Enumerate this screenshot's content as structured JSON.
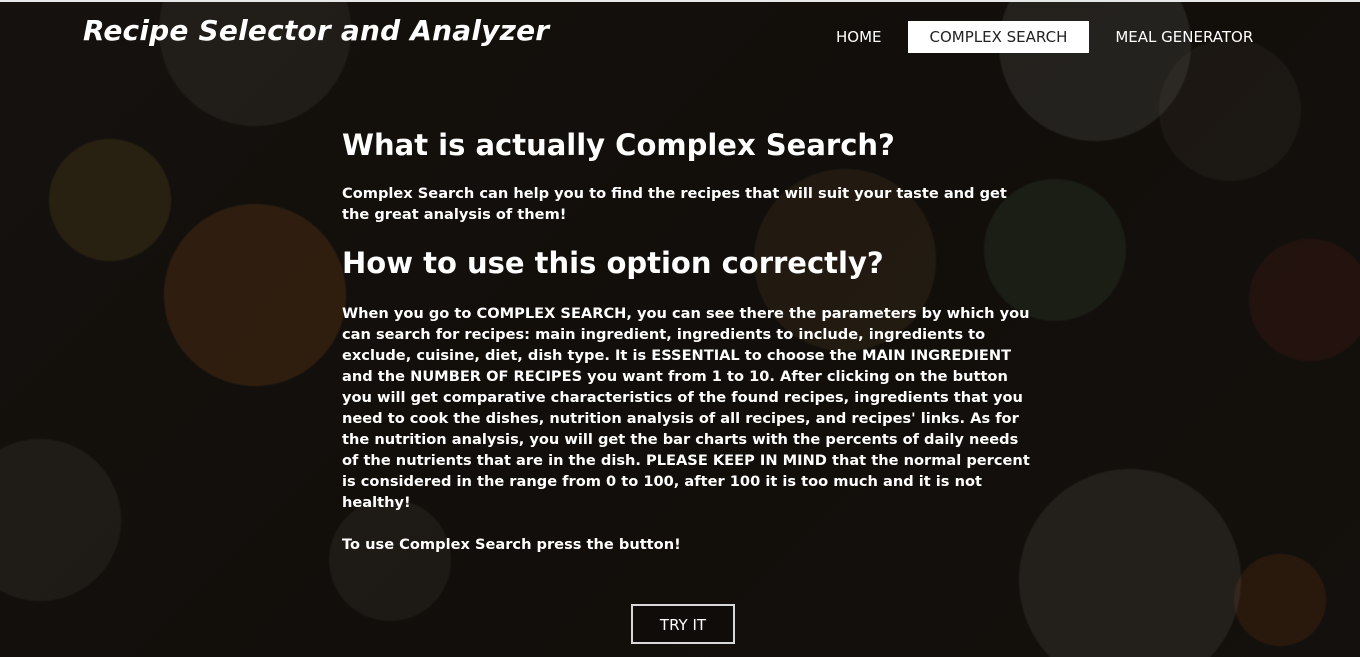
{
  "header": {
    "title": "Recipe Selector and Analyzer",
    "nav": [
      {
        "label": "HOME",
        "active": false
      },
      {
        "label": "COMPLEX SEARCH",
        "active": true
      },
      {
        "label": "MEAL GENERATOR",
        "active": false
      }
    ]
  },
  "main": {
    "heading1": "What is actually Complex Search?",
    "intro": "Complex Search can help you to find the recipes that will suit your taste and get the great analysis of them!",
    "heading2": "How to use this option correctly?",
    "body": "When you go to COMPLEX SEARCH, you can see there the parameters by which you can search for recipes: main ingredient, ingredients to include, ingredients to exclude, cuisine, diet, dish type. It is ESSENTIAL to choose the MAIN INGREDIENT and the NUMBER OF RECIPES you want from 1 to 10. After clicking on the button you will get comparative characteristics of the found recipes, ingredients that you need to cook the dishes, nutrition analysis of all recipes, and recipes' links. As for the nutrition analysis, you will get the bar charts with the percents of daily needs of the nutrients that are in the dish. PLEASE KEEP IN MIND that the normal percent is considered in the range from 0 to 100, after 100 it is too much and it is not healthy!",
    "cta_text": "To use Complex Search press the button!",
    "button_label": "TRY IT"
  },
  "colors": {
    "text": "#ffffff",
    "active_nav_bg": "#ffffff",
    "active_nav_text": "#222222",
    "background": "#151210"
  }
}
